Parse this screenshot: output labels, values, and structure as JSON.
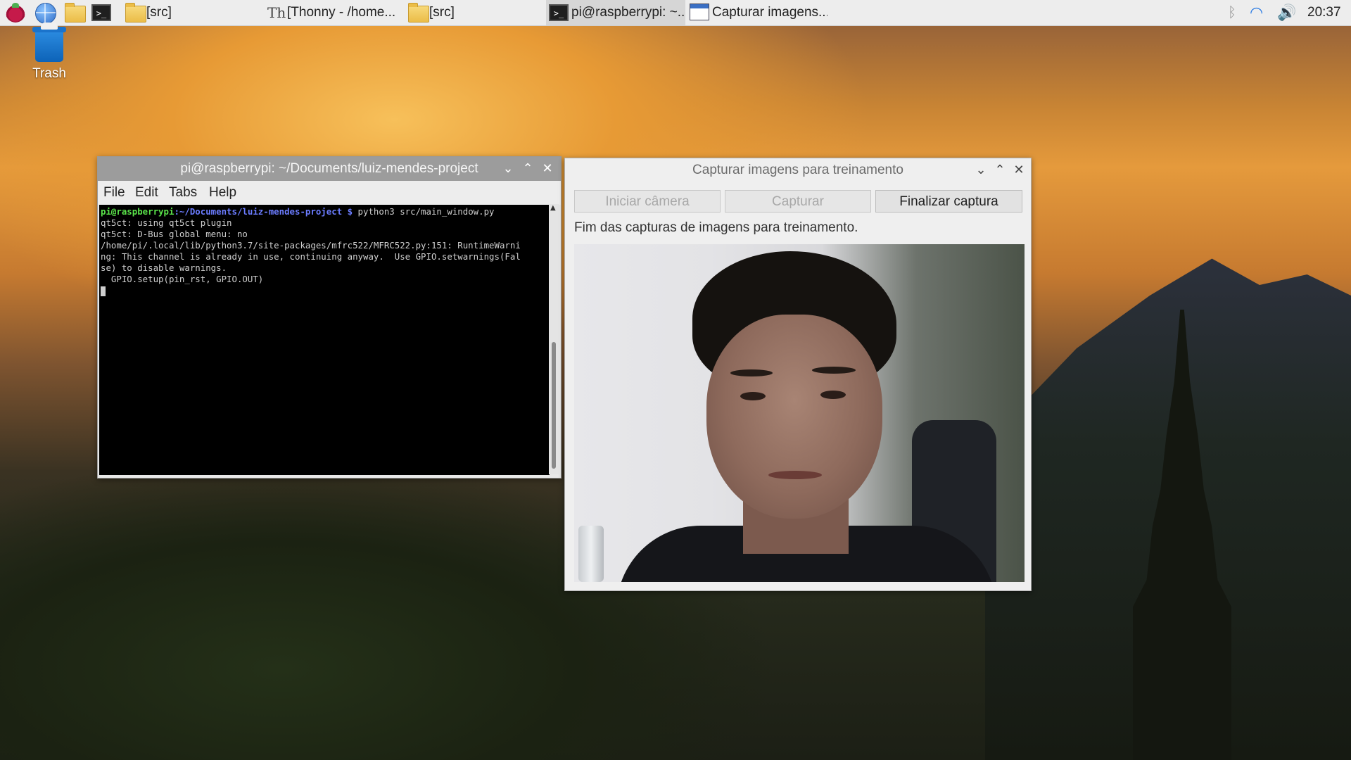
{
  "taskbar": {
    "tasks": [
      {
        "label": "[src]"
      },
      {
        "label": "[Thonny  -  /home..."
      },
      {
        "label": "[src]"
      },
      {
        "label": "pi@raspberrypi: ~..."
      },
      {
        "label": "Capturar imagens..."
      }
    ],
    "clock": "20:37"
  },
  "desktop": {
    "trash_label": "Trash"
  },
  "terminal": {
    "title": "pi@raspberrypi: ~/Documents/luiz-mendes-project",
    "menu": [
      "File",
      "Edit",
      "Tabs",
      "Help"
    ],
    "prompt_user": "pi@raspberrypi",
    "prompt_path": ":~/Documents/luiz-mendes-project $",
    "command": " python3 src/main_window.py",
    "output": [
      "qt5ct: using qt5ct plugin",
      "qt5ct: D-Bus global menu: no",
      "/home/pi/.local/lib/python3.7/site-packages/mfrc522/MFRC522.py:151: RuntimeWarni",
      "ng: This channel is already in use, continuing anyway.  Use GPIO.setwarnings(Fal",
      "se) to disable warnings.",
      "  GPIO.setup(pin_rst, GPIO.OUT)"
    ]
  },
  "capture": {
    "title": "Capturar imagens para treinamento",
    "buttons": {
      "start": "Iniciar câmera",
      "capture": "Capturar",
      "finish": "Finalizar captura"
    },
    "status": "Fim das capturas de imagens para treinamento."
  },
  "colors": {
    "accent": "#2a7be4",
    "terminal_bg": "#000000",
    "prompt_user": "#5ae34a",
    "prompt_path": "#6b7cff"
  },
  "icons": [
    "raspberry-menu-icon",
    "web-browser-icon",
    "file-manager-icon",
    "terminal-icon",
    "bluetooth-icon",
    "wifi-icon",
    "volume-icon",
    "trash-icon"
  ]
}
